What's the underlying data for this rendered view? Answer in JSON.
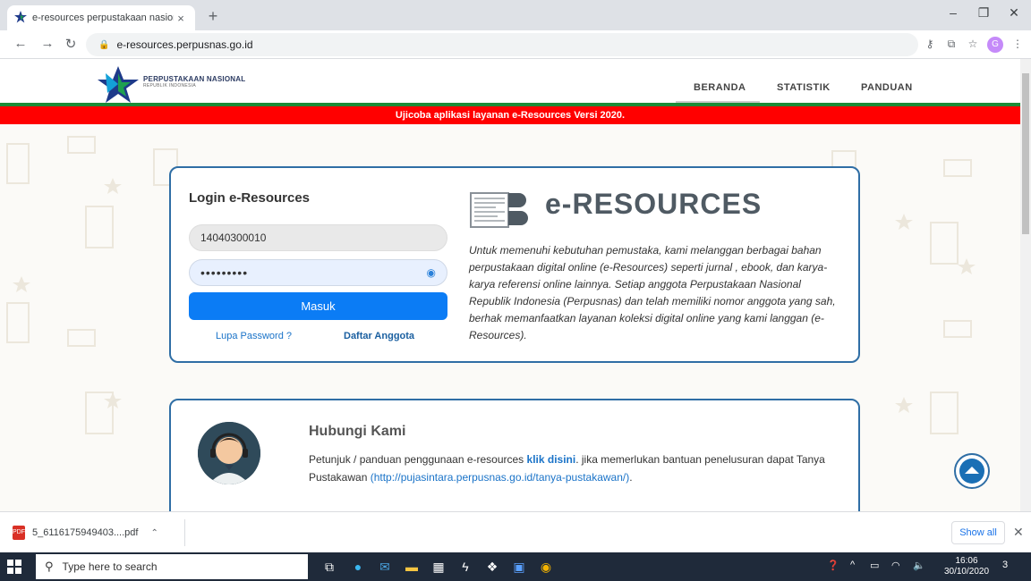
{
  "browser": {
    "tab_title": "e-resources perpustakaan nasion",
    "tab_close": "×",
    "new_tab": "+",
    "url": "e-resources.perpusnas.go.id",
    "profile_initial": "G",
    "minimize": "–",
    "restore": "❐",
    "close": "✕"
  },
  "site": {
    "logo_line1": "PERPUSTAKAAN NASIONAL",
    "logo_line2": "REPUBLIK INDONESIA",
    "nav": [
      "BERANDA",
      "STATISTIK",
      "PANDUAN"
    ],
    "banner": "Ujicoba aplikasi layanan e-Resources Versi 2020."
  },
  "login": {
    "title": "Login e-Resources",
    "username_value": "14040300010",
    "password_mask": "•••••••••",
    "submit_label": "Masuk",
    "forgot_label": "Lupa Password ?",
    "register_label": "Daftar Anggota"
  },
  "eresources": {
    "heading": "e-RESOURCES",
    "description": "Untuk memenuhi kebutuhan pemustaka, kami melanggan berbagai bahan perpustakaan digital online (e-Resources) seperti jurnal , ebook, dan karya-karya referensi online lainnya. Setiap anggota Perpustakaan Nasional Republik Indonesia (Perpusnas) dan telah memiliki nomor anggota yang sah, berhak memanfaatkan layanan koleksi digital online yang kami langgan (e-Resources)."
  },
  "contact": {
    "title": "Hubungi Kami",
    "text_before": "Petunjuk / panduan penggunaan e-resources ",
    "link_label": "klik disini",
    "text_middle": ". jika memerlukan bantuan penelusuran dapat Tanya Pustakawan ",
    "url_label": "(http://pujasintara.perpusnas.go.id/tanya-pustakawan/)",
    "text_after": "."
  },
  "download": {
    "filename": "5_6116175949403....pdf",
    "show_all": "Show all",
    "close": "✕"
  },
  "taskbar": {
    "search_placeholder": "Type here to search",
    "time": "16:06",
    "date": "30/10/2020",
    "notifications": "3"
  },
  "colors": {
    "banner_red": "#ff0000",
    "accent_green": "#1b8c37",
    "card_border": "#2f6ea5",
    "button_blue": "#0b7cf5"
  }
}
